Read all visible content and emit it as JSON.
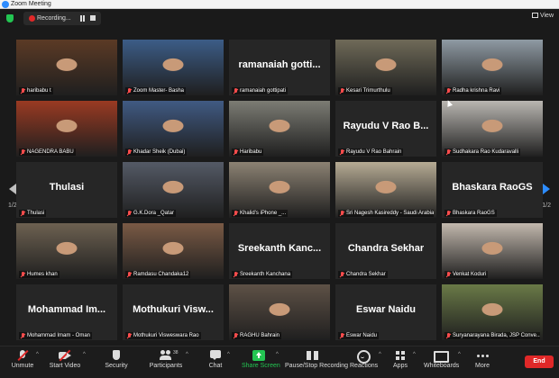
{
  "window": {
    "title": "Zoom Meeting"
  },
  "topbar": {
    "recording_text": "Recording...",
    "view_label": "View"
  },
  "navigation": {
    "page_left": "1/2",
    "page_right": "1/2"
  },
  "tiles": [
    {
      "label": "haribabu t",
      "video": true,
      "bg": "#5b3a25"
    },
    {
      "label": "Zoom Master- Basha",
      "video": true,
      "bg": "#3c5d87"
    },
    {
      "label": "ramanaiah gottipati",
      "big": "ramanaiah gotti...",
      "video": false
    },
    {
      "label": "Kesari Trimurthulu",
      "video": true,
      "bg": "#6f6a58",
      "active": true
    },
    {
      "label": "Radha krishna Ravi",
      "video": true,
      "bg": "#8f9aa3"
    },
    {
      "label": "NAGENDRA BABU",
      "video": true,
      "bg": "#9a3a22"
    },
    {
      "label": "Khadar Sheik (Dubai)",
      "video": true,
      "bg": "#405a83"
    },
    {
      "label": "Haribabu",
      "video": true,
      "bg": "#7c7c74"
    },
    {
      "label": "Rayudu V Rao Bahrain",
      "big": "Rayudu V Rao B...",
      "video": false
    },
    {
      "label": "Sudhakara Rao Kudaravalli",
      "video": true,
      "bg": "#b9b6b1"
    },
    {
      "label": "Thulasi",
      "big": "Thulasi",
      "video": false
    },
    {
      "label": "G.K.Dora _Qatar",
      "video": true,
      "bg": "#545a66"
    },
    {
      "label": "Khalid's iPhone _...",
      "video": true,
      "bg": "#8c8273"
    },
    {
      "label": "Sri Nagesh Kasireddy - Saudi Arabia",
      "video": true,
      "bg": "#b6ab94"
    },
    {
      "label": "Bhaskara RaoGS",
      "big": "Bhaskara RaoGS",
      "video": false
    },
    {
      "label": "Humes khan",
      "video": true,
      "bg": "#6d6151"
    },
    {
      "label": "Ramdasu Chandaka12",
      "video": true,
      "bg": "#7a5a45"
    },
    {
      "label": "Sreekanth Kanchana",
      "big": "Sreekanth Kanc...",
      "video": false
    },
    {
      "label": "Chandra Sekhar",
      "big": "Chandra Sekhar",
      "video": false
    },
    {
      "label": "Venkat Koduri",
      "video": true,
      "bg": "#c2b8ad"
    },
    {
      "label": "Mohammad Imam - Oman",
      "big": "Mohammad Im...",
      "video": false
    },
    {
      "label": "Mothukuri Visweswara Rao",
      "big": "Mothukuri Visw...",
      "video": false
    },
    {
      "label": "RAGHU Bahrain",
      "video": true,
      "bg": "#5e5146"
    },
    {
      "label": "Eswar Naidu",
      "big": "Eswar Naidu",
      "video": false
    },
    {
      "label": "Suryanarayana Birada, JSP Conve...",
      "video": true,
      "bg": "#6a7a47"
    }
  ],
  "toolbar": {
    "unmute": "Unmute",
    "start_video": "Start Video",
    "security": "Security",
    "participants": "Participants",
    "participants_count": "38",
    "chat": "Chat",
    "share_screen": "Share Screen",
    "record": "Pause/Stop Recording",
    "reactions": "Reactions",
    "apps": "Apps",
    "whiteboards": "Whiteboards",
    "more": "More",
    "end": "End"
  },
  "colors": {
    "accent": "#2d8cff",
    "share": "#23c552",
    "end": "#e02828",
    "active_border": "#9cdb3a"
  },
  "icons": [
    "shield-icon",
    "record-dot-icon",
    "pause-icon",
    "stop-icon",
    "grid-view-icon",
    "mic-muted-icon",
    "video-off-icon",
    "security-icon",
    "participants-icon",
    "chat-icon",
    "share-screen-icon",
    "pause-recording-icon",
    "reactions-icon",
    "apps-icon",
    "whiteboard-icon",
    "more-icon"
  ]
}
